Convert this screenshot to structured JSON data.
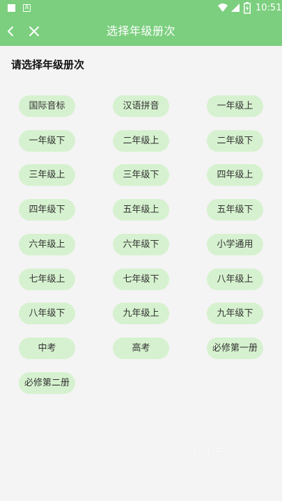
{
  "status_bar": {
    "time": "10:51",
    "icons": [
      "notification-square-icon",
      "a-icon",
      "wifi-icon",
      "signal-icon",
      "battery-icon"
    ]
  },
  "app_bar": {
    "title": "选择年级册次",
    "back_icon": "chevron-left-icon",
    "close_icon": "close-icon",
    "color": "#7ccf7f"
  },
  "section": {
    "title": "请选择年级册次"
  },
  "grades": [
    "国际音标",
    "汉语拼音",
    "一年级上",
    "一年级下",
    "二年级上",
    "二年级下",
    "三年级上",
    "三年级下",
    "四年级上",
    "四年级下",
    "五年级上",
    "五年级下",
    "六年级上",
    "六年级下",
    "小学通用",
    "七年级上",
    "七年级下",
    "八年级上",
    "八年级下",
    "九年级上",
    "九年级下",
    "中考",
    "高考",
    "必修第一册",
    "必修第二册"
  ],
  "watermark": "321手游网",
  "colors": {
    "pill_background": "#d6f1cf",
    "page_background": "#f4f4f4"
  }
}
